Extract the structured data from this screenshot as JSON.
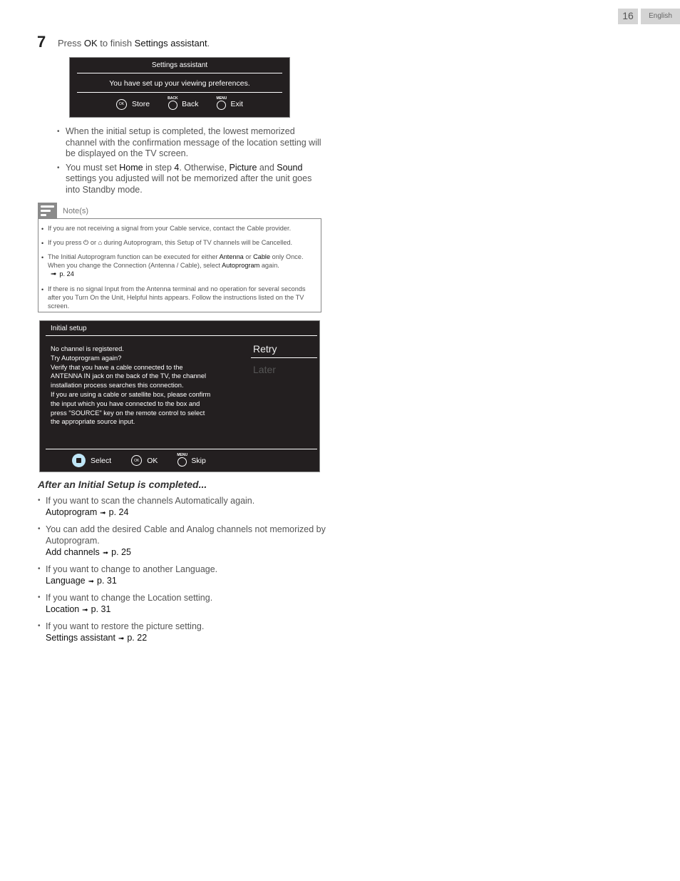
{
  "header": {
    "page_number": "16",
    "language": "English"
  },
  "step": {
    "number": "7",
    "text_parts": [
      "Press ",
      "OK",
      " to finish ",
      "Settings assistant",
      "."
    ]
  },
  "settings_dialog": {
    "title": "Settings assistant",
    "message": "You have set up your viewing preferences.",
    "controls": [
      {
        "key": "OK",
        "label": "Store"
      },
      {
        "key": "BACK",
        "label": "Back"
      },
      {
        "key": "MENU",
        "label": "Exit"
      }
    ]
  },
  "step_bullets": [
    {
      "text": "When the initial setup is completed, the lowest memorized channel with the confirmation message of the location setting will be displayed on the TV screen."
    },
    {
      "parts": [
        "You must set ",
        "Home",
        " in step ",
        "4",
        ". Otherwise, ",
        "Picture",
        " and ",
        "Sound",
        " settings you adjusted will not be memorized after the unit goes into Standby mode."
      ]
    }
  ],
  "notes": {
    "label": "Note(s)",
    "items": [
      {
        "text": "If you are not receiving a signal from your Cable service, contact the Cable provider."
      },
      {
        "before": "If you press ",
        "mid": " or ",
        "after": " during Autoprogram, this Setup of TV channels will be Cancelled.",
        "icon1": "power-icon",
        "icon2": "home-icon"
      },
      {
        "parts": [
          "The Initial Autoprogram function can be executed for either ",
          "Antenna",
          " or ",
          "Cable",
          " only Once. When you change the Connection (Antenna / Cable), select ",
          "Autoprogram",
          " again."
        ],
        "ref": "p. 24"
      },
      {
        "text": "If there is no signal Input from the Antenna terminal and no operation for several seconds after you Turn On the Unit, Helpful hints appears. Follow the instructions listed on the TV screen."
      }
    ]
  },
  "initial_setup_dialog": {
    "title": "Initial setup",
    "body_lines": [
      "No channel is registered.",
      "Try Autoprogram again?",
      "Verify that you have a cable connected to the",
      "ANTENNA IN jack on the back of the TV, the channel",
      "installation process searches this connection.",
      "If you are using a cable or satellite box, please confirm",
      "the input which you have connected to  the box and",
      "press \"SOURCE\" key on the remote control to select",
      "the appropriate source input."
    ],
    "options": [
      {
        "label": "Retry",
        "selected": true
      },
      {
        "label": "Later",
        "selected": false
      }
    ],
    "controls": [
      {
        "key": "NAV",
        "label": "Select"
      },
      {
        "key": "OK",
        "label": "OK"
      },
      {
        "key": "MENU",
        "label": "Skip"
      }
    ]
  },
  "after_setup": {
    "title": "After an Initial Setup is completed...",
    "items": [
      {
        "text": "If you want to scan the channels Automatically again.",
        "link": "Autoprogram",
        "page": "p. 24"
      },
      {
        "text": "You can add the desired Cable and Analog channels not memorized by Autoprogram.",
        "link": "Add channels",
        "page": "p. 25"
      },
      {
        "text": "If you want to change to another Language.",
        "link": "Language",
        "page": "p. 31"
      },
      {
        "text": "If you want to change the Location setting.",
        "link": "Location",
        "page": "p. 31"
      },
      {
        "text": "If you want to restore the picture setting.",
        "link": "Settings assistant",
        "page": "p. 22"
      }
    ],
    "arrow_glyph": "➟"
  }
}
